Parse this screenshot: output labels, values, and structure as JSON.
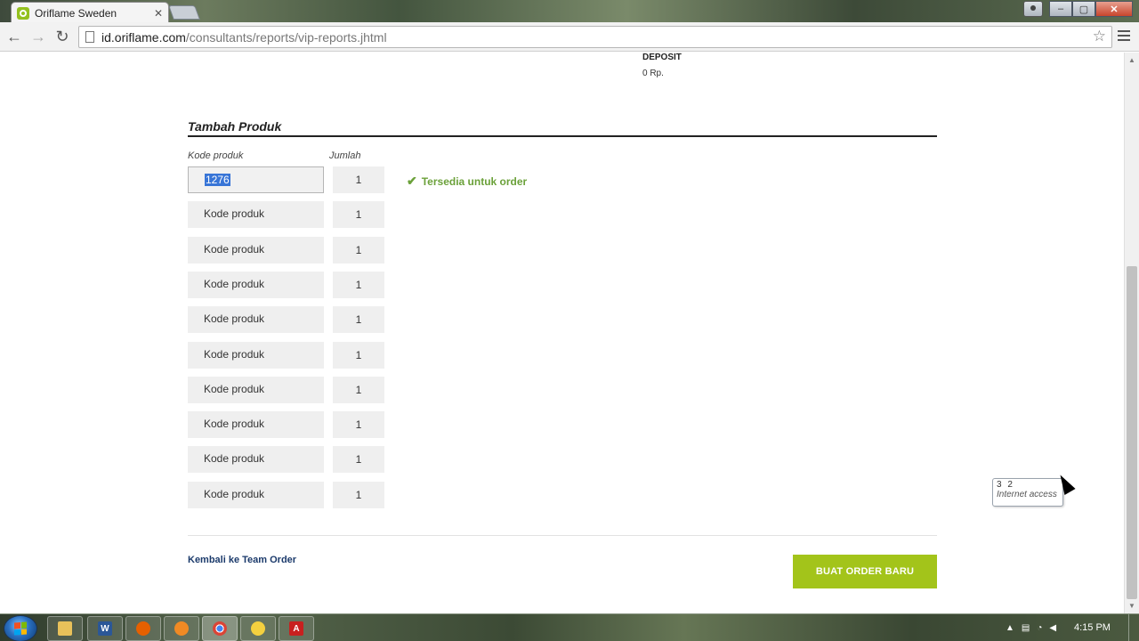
{
  "browser": {
    "tab_title": "Oriflame Sweden",
    "url_host": "id.oriflame.com",
    "url_path": "/consultants/reports/vip-reports.jhtml"
  },
  "deposit": {
    "label": "DEPOSIT",
    "value": "0 Rp."
  },
  "add_product": {
    "title": "Tambah Produk",
    "code_label": "Kode produk",
    "qty_label": "Jumlah",
    "rows": [
      {
        "code": "1276",
        "qty": "1"
      },
      {
        "code": "Kode produk",
        "qty": "1"
      },
      {
        "code": "Kode produk",
        "qty": "1"
      },
      {
        "code": "Kode produk",
        "qty": "1"
      },
      {
        "code": "Kode produk",
        "qty": "1"
      },
      {
        "code": "Kode produk",
        "qty": "1"
      },
      {
        "code": "Kode produk",
        "qty": "1"
      },
      {
        "code": "Kode produk",
        "qty": "1"
      },
      {
        "code": "Kode produk",
        "qty": "1"
      },
      {
        "code": "Kode produk",
        "qty": "1"
      }
    ],
    "availability": "Tersedia untuk order"
  },
  "footer": {
    "back_link": "Kembali ke Team Order",
    "order_button": "BUAT ORDER BARU"
  },
  "tooltip": {
    "line1": "3 2",
    "line2": "Internet access"
  },
  "taskbar": {
    "clock": "4:15 PM",
    "items": [
      "explorer",
      "word",
      "firefox",
      "app",
      "chrome",
      "app2",
      "acrobat"
    ]
  },
  "colors": {
    "accent_green": "#a3c41a",
    "available_green": "#6ba13a",
    "link_blue": "#1b3a6b"
  }
}
